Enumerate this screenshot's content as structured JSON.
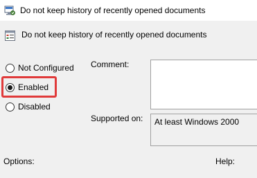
{
  "window": {
    "title": "Do not keep history of recently opened documents",
    "title_icon": "group-policy-setting-icon"
  },
  "header": {
    "setting_name": "Do not keep history of recently opened documents",
    "icon": "policy-document-icon"
  },
  "state_options": [
    {
      "label": "Not Configured",
      "selected": false
    },
    {
      "label": "Enabled",
      "selected": true
    },
    {
      "label": "Disabled",
      "selected": false
    }
  ],
  "comment": {
    "label": "Comment:",
    "value": ""
  },
  "supported_on": {
    "label": "Supported on:",
    "value": "At least Windows 2000"
  },
  "options": {
    "label": "Options:"
  },
  "help": {
    "label": "Help:"
  },
  "colors": {
    "highlight": "#e03a3a",
    "panel_background": "#f0f0f0"
  }
}
